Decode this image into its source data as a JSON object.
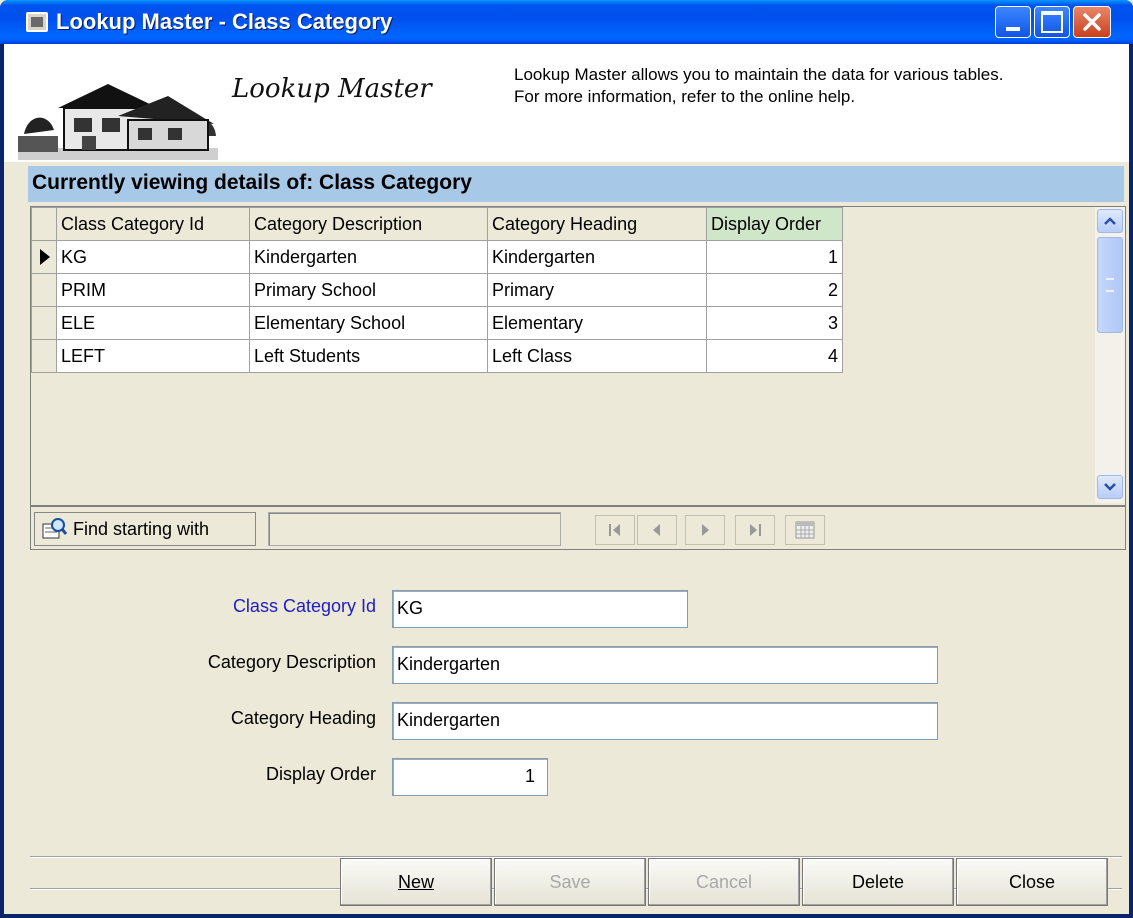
{
  "window": {
    "title": "Lookup Master - Class Category"
  },
  "header": {
    "heading": "Lookup Master",
    "info_line1": "Lookup Master allows you to maintain the data for various tables.",
    "info_line2": "For more information, refer to the online help."
  },
  "viewing": {
    "text": "Currently viewing details of: Class Category"
  },
  "grid": {
    "columns": [
      "Class Category Id",
      "Category Description",
      "Category Heading",
      "Display Order"
    ],
    "rows": [
      {
        "id": "KG",
        "description": "Kindergarten",
        "heading": "Kindergarten",
        "order": "1"
      },
      {
        "id": "PRIM",
        "description": "Primary School",
        "heading": "Primary",
        "order": "2"
      },
      {
        "id": "ELE",
        "description": "Elementary School",
        "heading": "Elementary",
        "order": "3"
      },
      {
        "id": "LEFT",
        "description": "Left Students",
        "heading": "Left Class",
        "order": "4"
      }
    ],
    "selected_row": 0
  },
  "toolbar": {
    "find_label": "Find starting with",
    "find_value": ""
  },
  "form": {
    "id_label": "Class Category Id",
    "id_value": "KG",
    "description_label": "Category Description",
    "description_value": "Kindergarten",
    "heading_label": "Category Heading",
    "heading_value": "Kindergarten",
    "order_label": "Display Order",
    "order_value": "1"
  },
  "actions": {
    "new": "New",
    "save": "Save",
    "cancel": "Cancel",
    "delete": "Delete",
    "close": "Close"
  },
  "colors": {
    "titlebar": "#0050ee",
    "viewing_bar": "#a8c8e8",
    "primary_label": "#2020c0",
    "sorted_header": "#cfe6c8"
  }
}
